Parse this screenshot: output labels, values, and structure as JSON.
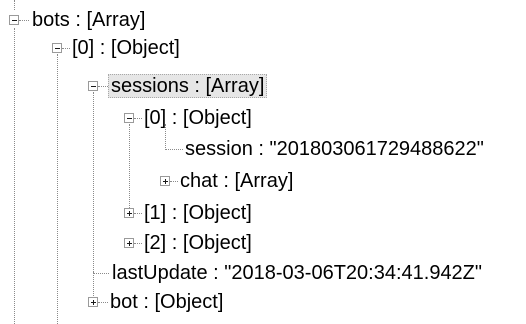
{
  "tree": {
    "root": {
      "label": "bots : [Array]",
      "expanded": true,
      "children": {
        "item0": {
          "label": "[0] : [Object]",
          "expanded": true,
          "children": {
            "sessions": {
              "label": "sessions : [Array]",
              "expanded": true,
              "selected": true,
              "children": {
                "item0": {
                  "label": "[0] : [Object]",
                  "expanded": true,
                  "children": {
                    "session": {
                      "label": "session : \"201803061729488622\""
                    },
                    "chat": {
                      "label": "chat : [Array]",
                      "expanded": false
                    }
                  }
                },
                "item1": {
                  "label": "[1] : [Object]",
                  "expanded": false
                },
                "item2": {
                  "label": "[2] : [Object]",
                  "expanded": false
                }
              }
            },
            "lastUpdate": {
              "label": "lastUpdate : \"2018-03-06T20:34:41.942Z\""
            },
            "bot": {
              "label": "bot : [Object]",
              "expanded": false
            }
          }
        }
      }
    }
  },
  "icons": {
    "expanded": "minus-box-icon",
    "collapsed": "plus-box-icon"
  },
  "colors": {
    "background": "#ffffff",
    "text": "#000000",
    "connector": "#8a8a8a",
    "selection": "#e6e6e6"
  }
}
